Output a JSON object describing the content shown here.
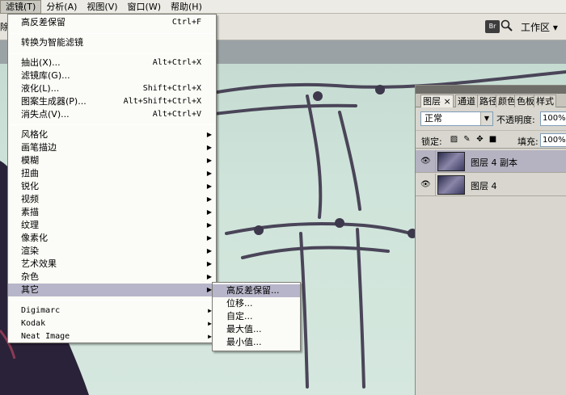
{
  "menubar": {
    "items": [
      {
        "label": "滤镜(T)",
        "active": true
      },
      {
        "label": "分析(A)"
      },
      {
        "label": "视图(V)"
      },
      {
        "label": "窗口(W)"
      },
      {
        "label": "帮助(H)"
      }
    ]
  },
  "options_bar": {
    "cut_text": "除",
    "bridge_label": "Br",
    "workspace_label": "工作区 ▾"
  },
  "filter_menu": {
    "last_filter": {
      "label": "高反差保留",
      "shortcut": "Ctrl+F"
    },
    "smart_filter": "转换为智能滤镜",
    "items_a": [
      {
        "label": "抽出(X)...",
        "shortcut": "Alt+Ctrl+X"
      },
      {
        "label": "滤镜库(G)...",
        "shortcut": ""
      },
      {
        "label": "液化(L)...",
        "shortcut": "Shift+Ctrl+X"
      },
      {
        "label": "图案生成器(P)...",
        "shortcut": "Alt+Shift+Ctrl+X"
      },
      {
        "label": "消失点(V)...",
        "shortcut": "Alt+Ctrl+V"
      }
    ],
    "submenus": [
      "风格化",
      "画笔描边",
      "模糊",
      "扭曲",
      "锐化",
      "视频",
      "素描",
      "纹理",
      "像素化",
      "渲染",
      "艺术效果",
      "杂色",
      "其它"
    ],
    "plugins": [
      "Digimarc",
      "Kodak",
      "Neat Image"
    ],
    "highlighted": "其它"
  },
  "other_submenu": {
    "items": [
      "高反差保留...",
      "位移...",
      "自定...",
      "最大值...",
      "最小值..."
    ],
    "highlighted": "高反差保留..."
  },
  "layers_panel": {
    "tabs": [
      "图层",
      "×",
      "通道",
      "路径",
      "颜色",
      "色板",
      "样式"
    ],
    "blend_mode": "正常",
    "opacity_label": "不透明度:",
    "opacity_value": "100%",
    "lock_label": "锁定:",
    "fill_label": "填充:",
    "fill_value": "100%",
    "layers": [
      {
        "name": "图层 4 副本",
        "selected": true
      },
      {
        "name": "图层 4",
        "selected": false
      }
    ]
  },
  "colors": {
    "menu_highlight": "#b7b5c9",
    "canvas_bg": "#cfe4da"
  }
}
